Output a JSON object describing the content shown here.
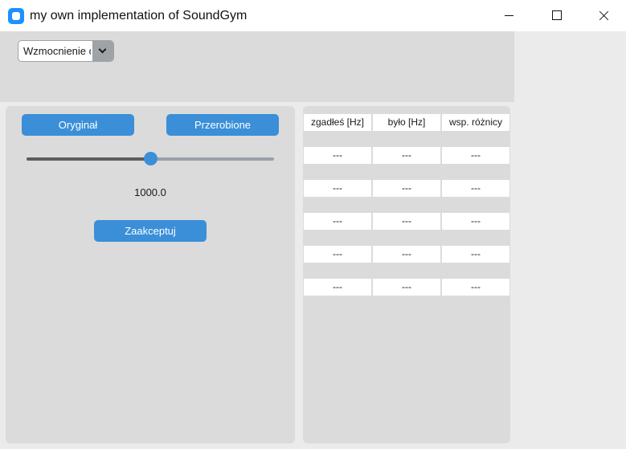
{
  "window": {
    "title": "my own implementation of SoundGym"
  },
  "mode_select": {
    "value": "Wzmocnienie c"
  },
  "buttons": {
    "original": "Oryginał",
    "processed": "Przerobione",
    "accept": "Zaakceptuj"
  },
  "slider": {
    "value_label": "1000.0",
    "fraction": 0.5
  },
  "results_table": {
    "headers": [
      "zgadłeś [Hz]",
      "było [Hz]",
      "wsp. różnicy"
    ],
    "rows": [
      [
        "---",
        "---",
        "---"
      ],
      [
        "---",
        "---",
        "---"
      ],
      [
        "---",
        "---",
        "---"
      ],
      [
        "---",
        "---",
        "---"
      ],
      [
        "---",
        "---",
        "---"
      ]
    ]
  },
  "colors": {
    "accent": "#3a8fd8",
    "panel": "#dbdbdb",
    "background": "#ebebeb"
  }
}
